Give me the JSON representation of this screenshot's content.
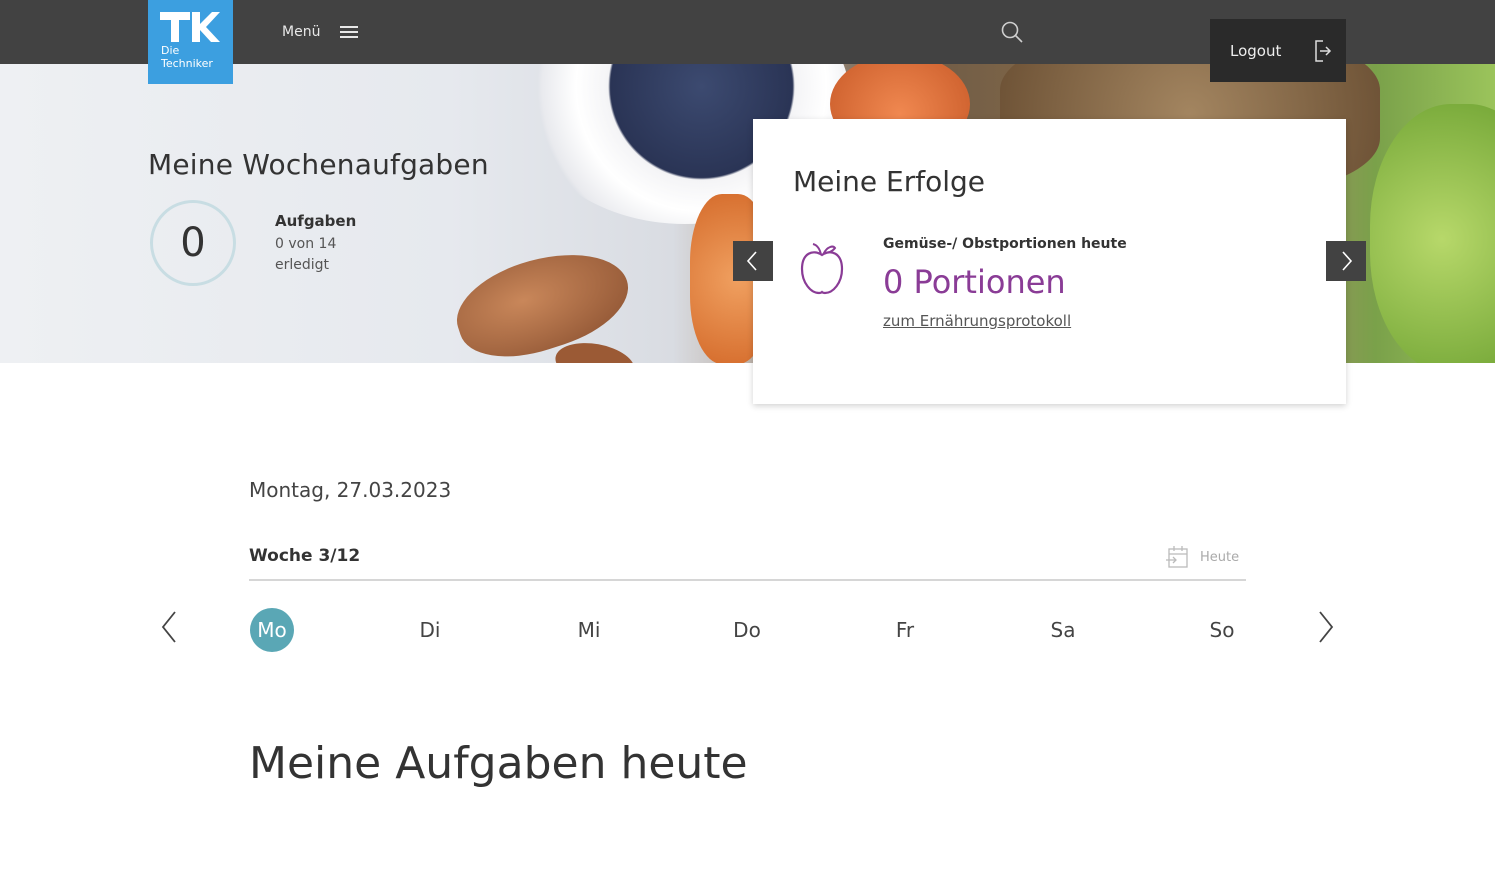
{
  "header": {
    "logo": {
      "line1": "Die",
      "line2": "Techniker"
    },
    "menu_label": "Menü",
    "logout_label": "Logout",
    "icons": {
      "menu": "hamburger-icon",
      "search": "search-icon",
      "logout": "logout-icon"
    }
  },
  "hero": {
    "title": "Meine Wochenaufgaben",
    "progress_value": "0",
    "tasks_label": "Aufgaben",
    "tasks_count": "0 von 14",
    "tasks_done": "erledigt"
  },
  "success_card": {
    "title": "Meine Erfolge",
    "subtitle": "Gemüse-/ Obstportionen heute",
    "value": "0 Portionen",
    "link": "zum Ernährungsprotokoll",
    "icon": "apple-icon",
    "accent_color": "#8a3c96"
  },
  "calendar": {
    "date": "Montag, 27.03.2023",
    "week": "Woche 3/12",
    "today_label": "Heute",
    "days": [
      {
        "label": "Mo",
        "active": true
      },
      {
        "label": "Di",
        "active": false
      },
      {
        "label": "Mi",
        "active": false
      },
      {
        "label": "Do",
        "active": false
      },
      {
        "label": "Fr",
        "active": false
      },
      {
        "label": "Sa",
        "active": false
      },
      {
        "label": "So",
        "active": false
      }
    ],
    "active_color": "#5aa7b5"
  },
  "tasks_section": {
    "title": "Meine Aufgaben heute"
  }
}
